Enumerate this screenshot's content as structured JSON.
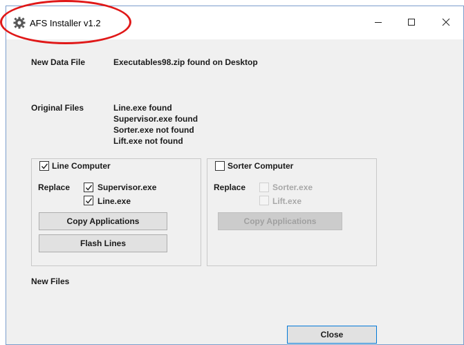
{
  "window": {
    "title": "AFS Installer v1.2",
    "icon": "gear-icon"
  },
  "new_data_file": {
    "label": "New Data File",
    "value": "Executables98.zip found on Desktop"
  },
  "original_files": {
    "label": "Original Files",
    "lines": [
      "Line.exe found",
      "Supervisor.exe found",
      "Sorter.exe not found",
      "Lift.exe not found"
    ]
  },
  "line_computer": {
    "checkbox_label": "Line Computer",
    "checked": true,
    "replace_label": "Replace",
    "options": [
      {
        "label": "Supervisor.exe",
        "checked": true
      },
      {
        "label": "Line.exe",
        "checked": true
      }
    ],
    "copy_button": "Copy Applications",
    "flash_button": "Flash Lines"
  },
  "sorter_computer": {
    "checkbox_label": "Sorter Computer",
    "checked": false,
    "replace_label": "Replace",
    "options": [
      {
        "label": "Sorter.exe",
        "checked": false,
        "disabled": true
      },
      {
        "label": "Lift.exe",
        "checked": false,
        "disabled": true
      }
    ],
    "copy_button": "Copy Applications"
  },
  "new_files": {
    "label": "New Files"
  },
  "footer": {
    "close_button": "Close"
  },
  "colors": {
    "annotation": "#e01818",
    "window_bg": "#f0f0f0",
    "close_border": "#0078d7"
  }
}
